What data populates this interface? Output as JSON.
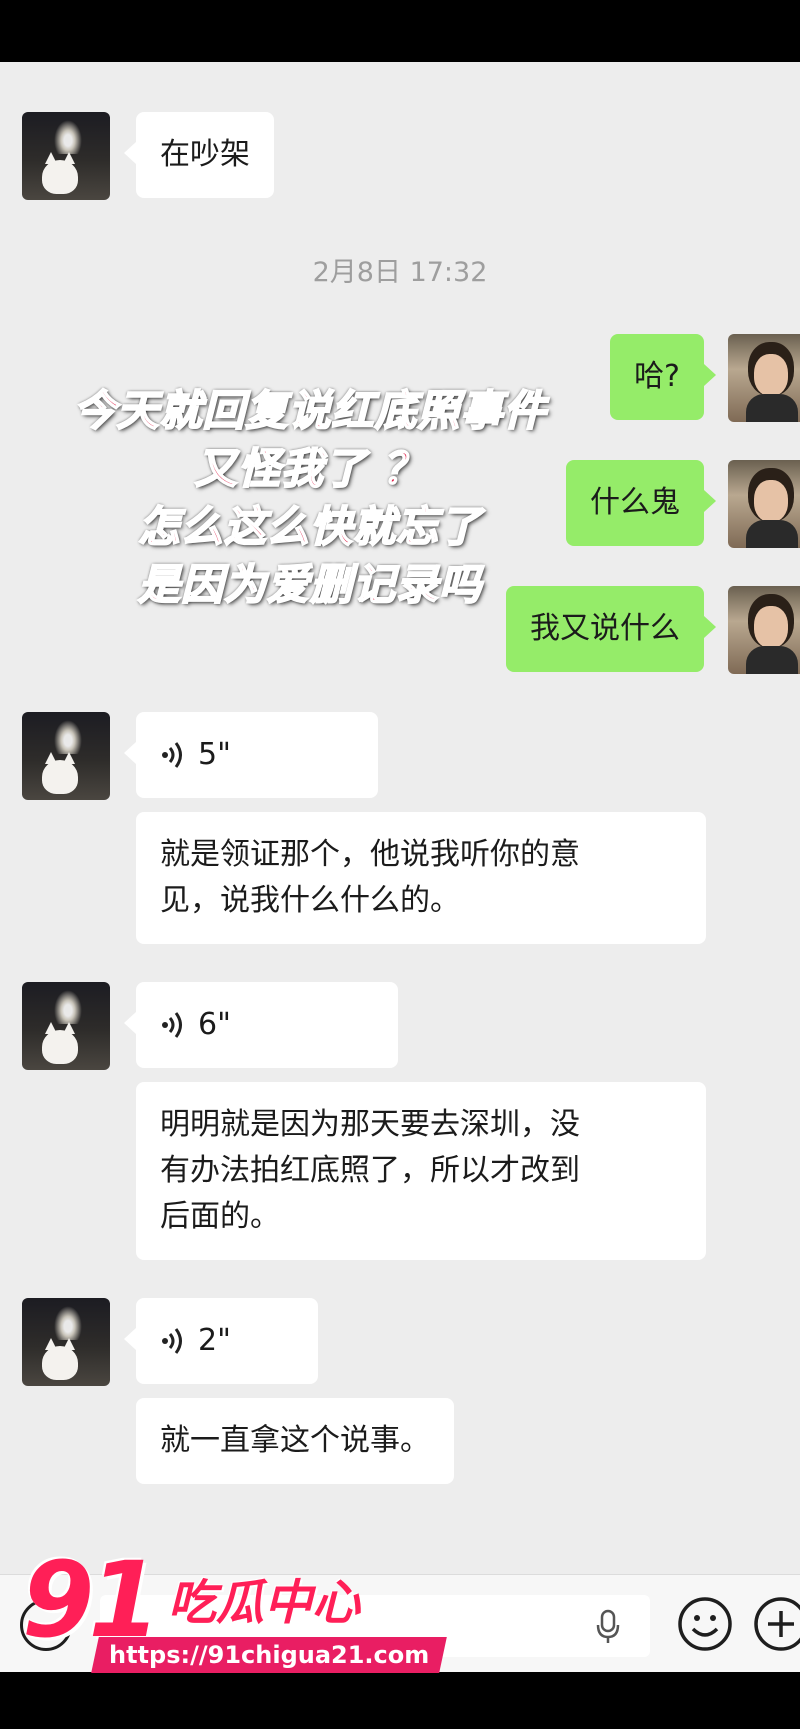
{
  "chat": {
    "timestamp": "2月8日 17:32",
    "messages": [
      {
        "from": "friend",
        "type": "text",
        "text": "在吵架"
      },
      {
        "from": "self",
        "type": "text",
        "text": "哈?"
      },
      {
        "from": "self",
        "type": "text",
        "text": "什么鬼"
      },
      {
        "from": "self",
        "type": "text",
        "text": "我又说什么"
      },
      {
        "from": "friend",
        "type": "voice",
        "duration": "5\""
      },
      {
        "from": "friend",
        "type": "text",
        "text_line1": "就是领证那个，他说我听你的意",
        "text_line2": "见，说我什么什么的。"
      },
      {
        "from": "friend",
        "type": "voice",
        "duration": "6\""
      },
      {
        "from": "friend",
        "type": "text",
        "text_line1": "明明就是因为那天要去深圳，没",
        "text_line2": "有办法拍红底照了，所以才改到",
        "text_line3": "后面的。"
      },
      {
        "from": "friend",
        "type": "voice",
        "duration": "2\""
      },
      {
        "from": "friend",
        "type": "text",
        "text": "就一直拿这个说事。"
      }
    ]
  },
  "overlay_caption": {
    "line1": "今天就回复说红底照事件",
    "line2": "又怪我了 ？",
    "line3": "怎么这么快就忘了",
    "line4": "是因为爱删记录吗"
  },
  "input_bar": {
    "icons": [
      "voice-toggle-icon",
      "microphone-icon",
      "emoji-icon",
      "plus-icon"
    ]
  },
  "watermark": {
    "number": "91",
    "name": "吃瓜中心",
    "url": "https://91chigua21.com"
  },
  "colors": {
    "chat_background": "#ededed",
    "self_bubble": "#95ec69",
    "friend_bubble": "#ffffff",
    "caption": "#e01e47",
    "watermark": "#ff1f57"
  }
}
